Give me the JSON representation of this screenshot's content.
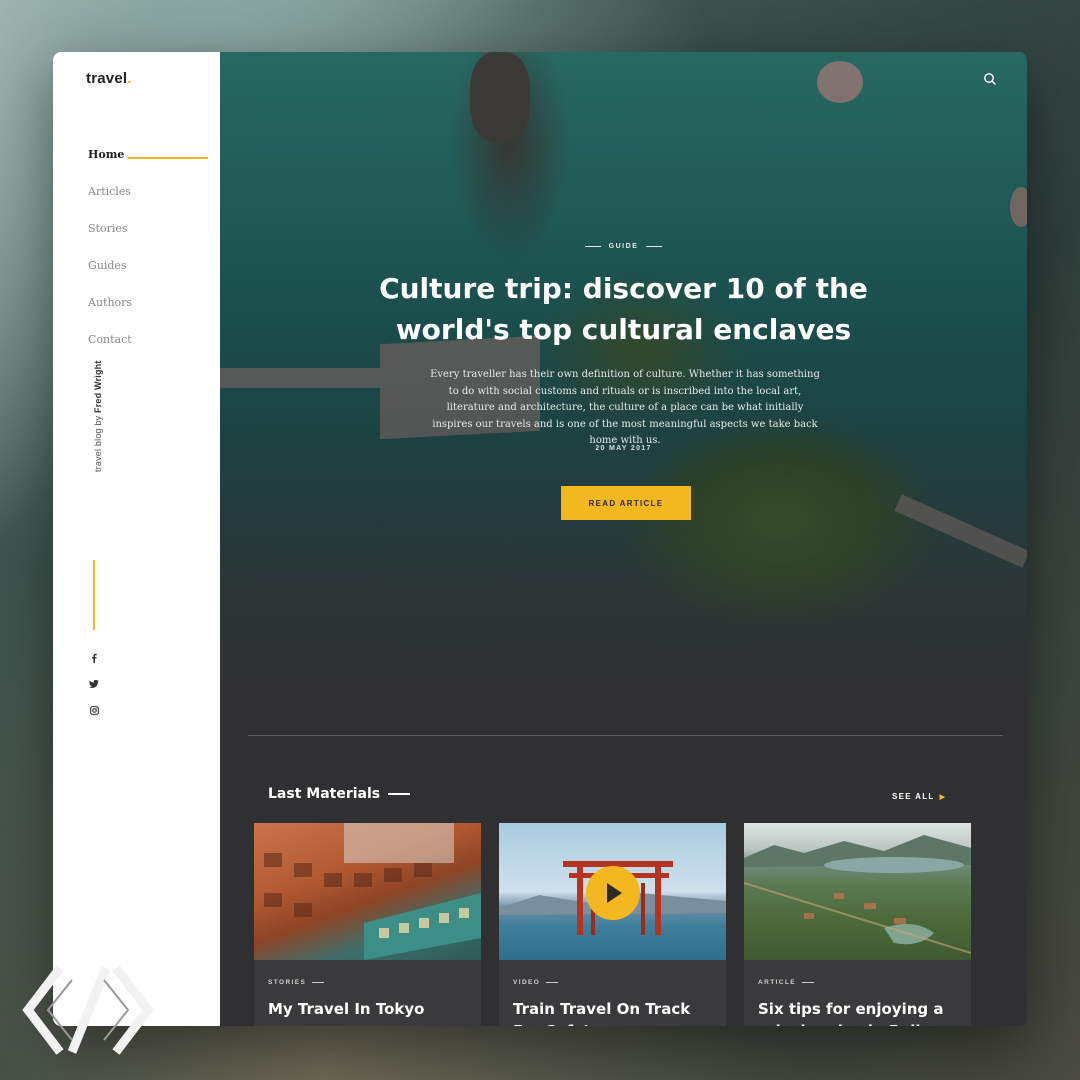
{
  "brand": {
    "name": "travel",
    "dot": ".",
    "accent_color": "#f3b81f"
  },
  "nav": {
    "items": [
      {
        "label": "Home",
        "active": true
      },
      {
        "label": "Articles"
      },
      {
        "label": "Stories"
      },
      {
        "label": "Guides"
      },
      {
        "label": "Authors"
      },
      {
        "label": "Contact"
      }
    ]
  },
  "sidebar": {
    "tagline_prefix": "travel blog by ",
    "author": "Fred Wright",
    "social": [
      "facebook-icon",
      "twitter-icon",
      "instagram-icon"
    ]
  },
  "header": {
    "search_icon": "search-icon"
  },
  "hero": {
    "category": "GUIDE",
    "title": "Culture trip: discover 10 of the world's top cultural enclaves",
    "description": "Every traveller has their own definition of culture. Whether it has something to do with social customs and rituals or is inscribed into the local art, literature and architecture, the culture of a place can be what initially inspires our travels and is one of the most meaningful aspects we take back home with us.",
    "date": "20 MAY 2017",
    "button_label": "READ ARTICLE"
  },
  "materials": {
    "title": "Last Materials",
    "see_all": "SEE ALL",
    "cards": [
      {
        "category": "STORIES",
        "title": "My Travel In Tokyo"
      },
      {
        "category": "VIDEO",
        "title": "Train Travel On Track For Safety",
        "play_icon": "play-icon"
      },
      {
        "category": "ARTICLE",
        "title": "Six tips for enjoying a relaxing day in Bali"
      }
    ]
  }
}
